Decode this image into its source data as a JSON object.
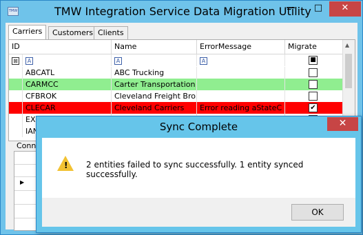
{
  "window": {
    "title": "TMW Integration Service Data Migration Utility",
    "icon_text": "TMW",
    "min_glyph": "—",
    "max_glyph": "□",
    "close_glyph": "✕"
  },
  "tabs": [
    "Carriers",
    "Customers",
    "Clients"
  ],
  "grid": {
    "columns": [
      "ID",
      "Name",
      "ErrorMessage",
      "Migrate"
    ],
    "filter_glyph": "A",
    "rows": [
      {
        "id": "ABCATL",
        "name": "ABC Trucking",
        "error": "",
        "migrate": false,
        "style": "plain"
      },
      {
        "id": "CARMCC",
        "name": "Carter Transportation",
        "error": "",
        "migrate": false,
        "style": "green"
      },
      {
        "id": "CFBROK",
        "name": "Cleveland Freight Bro...",
        "error": "",
        "migrate": false,
        "style": "plain"
      },
      {
        "id": "CLECAR",
        "name": "Cleveland Carriers",
        "error": "Error reading aStateC",
        "migrate": true,
        "style": "red"
      },
      {
        "id": "EXP",
        "name": "",
        "error": "",
        "migrate": false,
        "style": "plain"
      },
      {
        "id": "IAN",
        "name": "",
        "error": "",
        "migrate": false,
        "style": "plain"
      }
    ]
  },
  "lower_label": "Conn",
  "dialog": {
    "title": "Sync Complete",
    "message": "2 entities failed to sync successfully. 1 entity synced successfully.",
    "ok_label": "OK",
    "close_glyph": "✕",
    "warning_mark": "!"
  },
  "colors": {
    "titlebar": "#6fc3ea",
    "row_green": "#90ee90",
    "row_red": "#ff0000"
  }
}
